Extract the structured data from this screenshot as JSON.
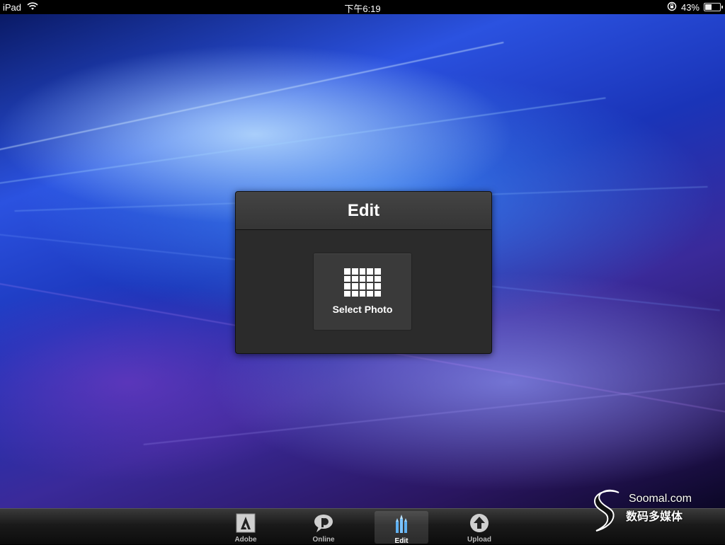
{
  "status_bar": {
    "device": "iPad",
    "time": "下午6:19",
    "battery_text": "43%",
    "battery_level": 0.43
  },
  "dialog": {
    "title": "Edit",
    "select_photo_label": "Select Photo"
  },
  "tabbar": {
    "tabs": [
      {
        "label": "Adobe",
        "icon": "adobe-logo-icon"
      },
      {
        "label": "Online",
        "icon": "speech-bubble-icon"
      },
      {
        "label": "Edit",
        "icon": "pencils-icon",
        "active": true
      },
      {
        "label": "Upload",
        "icon": "upload-arrow-icon"
      }
    ]
  },
  "watermark": {
    "site": "Soomal.com",
    "tagline": "数码多媒体"
  },
  "colors": {
    "dialog_bg": "#2b2b2b",
    "dialog_header": "#3c3c3c",
    "tabbar_bg": "#1a1a1a",
    "active_tab_icon": "#5fb0f0"
  }
}
